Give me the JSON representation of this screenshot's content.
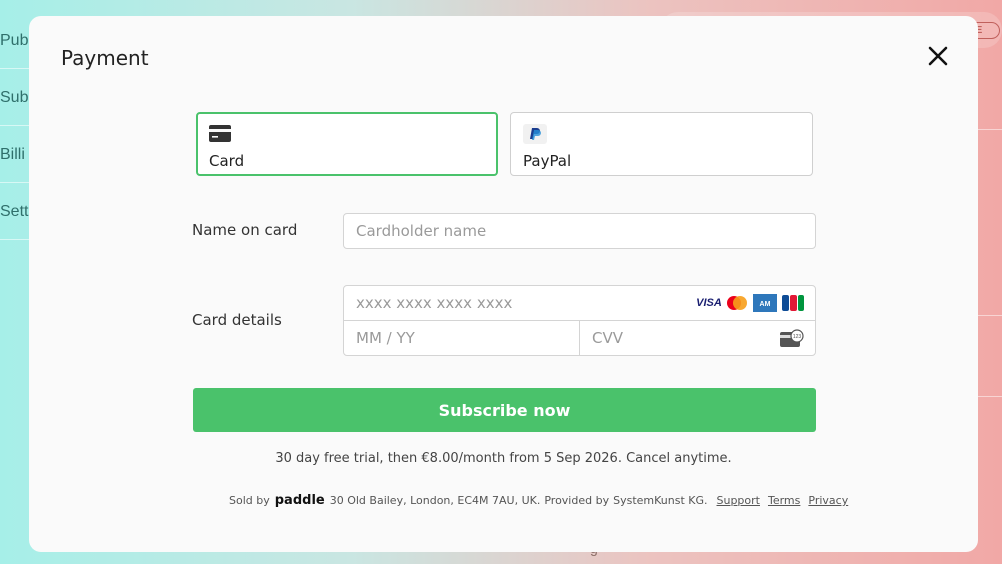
{
  "background": {
    "sidebar_items": [
      "Pub",
      "Subs",
      "Billi",
      "Setti"
    ],
    "badge": "EE",
    "bottom_text": "g"
  },
  "modal": {
    "title": "Payment",
    "close_icon": "close-icon"
  },
  "methods": [
    {
      "label": "Card",
      "icon": "credit-card-icon",
      "selected": true
    },
    {
      "label": "PayPal",
      "icon": "paypal-icon",
      "selected": false
    }
  ],
  "form": {
    "name_label": "Name on card",
    "name_placeholder": "Cardholder name",
    "details_label": "Card details",
    "number_placeholder": "xxxx xxxx xxxx xxxx",
    "expiry_placeholder": "MM / YY",
    "cvv_placeholder": "CVV",
    "brands": [
      "VISA",
      "Mastercard",
      "AMEX",
      "JCB"
    ],
    "cvv_hint": "123"
  },
  "subscribe_label": "Subscribe now",
  "trial_text": "30 day free trial, then €8.00/month from 5 Sep 2026. Cancel anytime.",
  "footer": {
    "sold_by": "Sold by",
    "brand": "paddle",
    "address": "30 Old Bailey, London, EC4M 7AU, UK.",
    "provided_by": "Provided by",
    "provider": "SystemKunst KG.",
    "links": [
      "Support",
      "Terms",
      "Privacy"
    ]
  },
  "colors": {
    "accent": "#4ac26b",
    "modal_bg": "#fafafa"
  }
}
